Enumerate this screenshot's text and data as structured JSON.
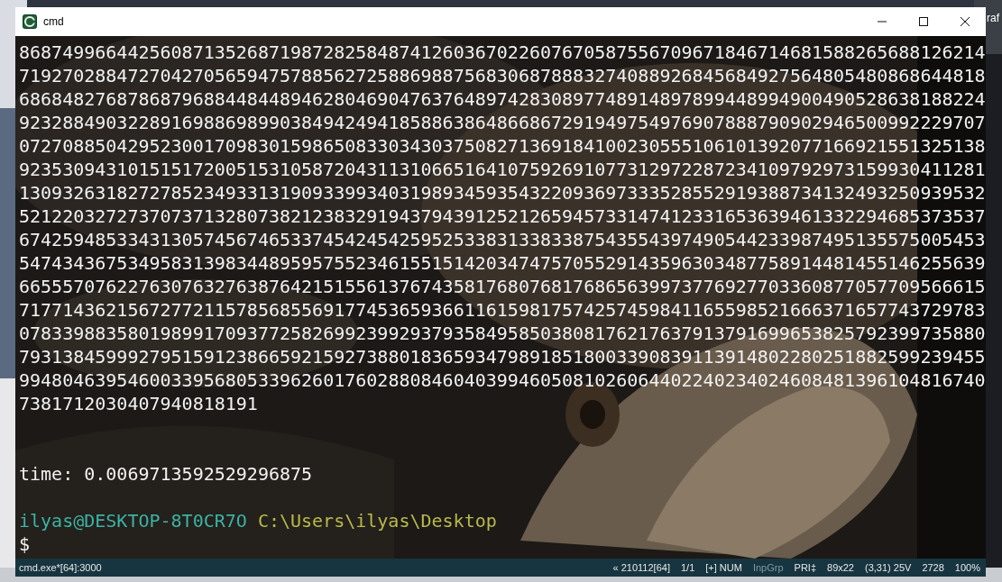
{
  "desktop": {
    "label_fragment": "raf"
  },
  "window": {
    "title": "cmd"
  },
  "console": {
    "output_lines": [
      "86874996644256087135268719872825848741260367022607670587556709671846714681588265688126214",
      "71927028847270427056594757885627258869887568306878883274088926845684927564805480868644818",
      "68684827687868796884484489462804690476376489742830897748914897899448994900490528638188224",
      "92328849032289169886989903849424941858863864866867291949754976907888790902946500992229707",
      "07270885042952300170983015986508330343037508271369184100230555106101392077166921551325138",
      "92353094310151517200515310587204311310665164107592691077312972287234109792973159930411281",
      "13093263182727852349331319093399340319893459354322093697333528552919388734132493250939532",
      "52122032727370737132807382123832919437943912521265945733147412331653639461332294685373537",
      "67425948533431305745674653374542454259525338313383387543554397490544233987495135575005453",
      "54743436753495831398344895957552346155151420347475705529143596303487758914481455146255639",
      "66555707622763076327638764215155613767435817680768176865639973776927703360877057709566615",
      "71771436215672772115785685569177453659366116159817574257459841165598521666371657743729783",
      "07833988358019899170937725826992399293793584958503808176217637913791699653825792399735880",
      "79313845999279515912386659215927388018365934798918518003390839113914802280251882599239455",
      "99480463954600339568053396260176028808460403994605081026064402240234024608481396104816740",
      "7381712030407940818191"
    ],
    "time_line": "time: 0.0069713592529296875",
    "prompt": {
      "user_host": "ilyas@DESKTOP-8T0CR7O",
      "path": "C:\\Users\\ilyas\\Desktop",
      "symbol": "$"
    }
  },
  "status_bar": {
    "left": "cmd.exe*[64]:3000",
    "items": [
      {
        "text": "« 210112[64]",
        "disabled": false
      },
      {
        "text": "1/1",
        "disabled": false
      },
      {
        "text": "[+] NUM",
        "disabled": false
      },
      {
        "text": "InpGrp",
        "disabled": true
      },
      {
        "text": "PRI‡",
        "disabled": false
      },
      {
        "text": "89x22",
        "disabled": false
      },
      {
        "text": "(3,31) 25V",
        "disabled": false
      },
      {
        "text": "2728",
        "disabled": false
      },
      {
        "text": "100%",
        "disabled": false
      }
    ]
  }
}
